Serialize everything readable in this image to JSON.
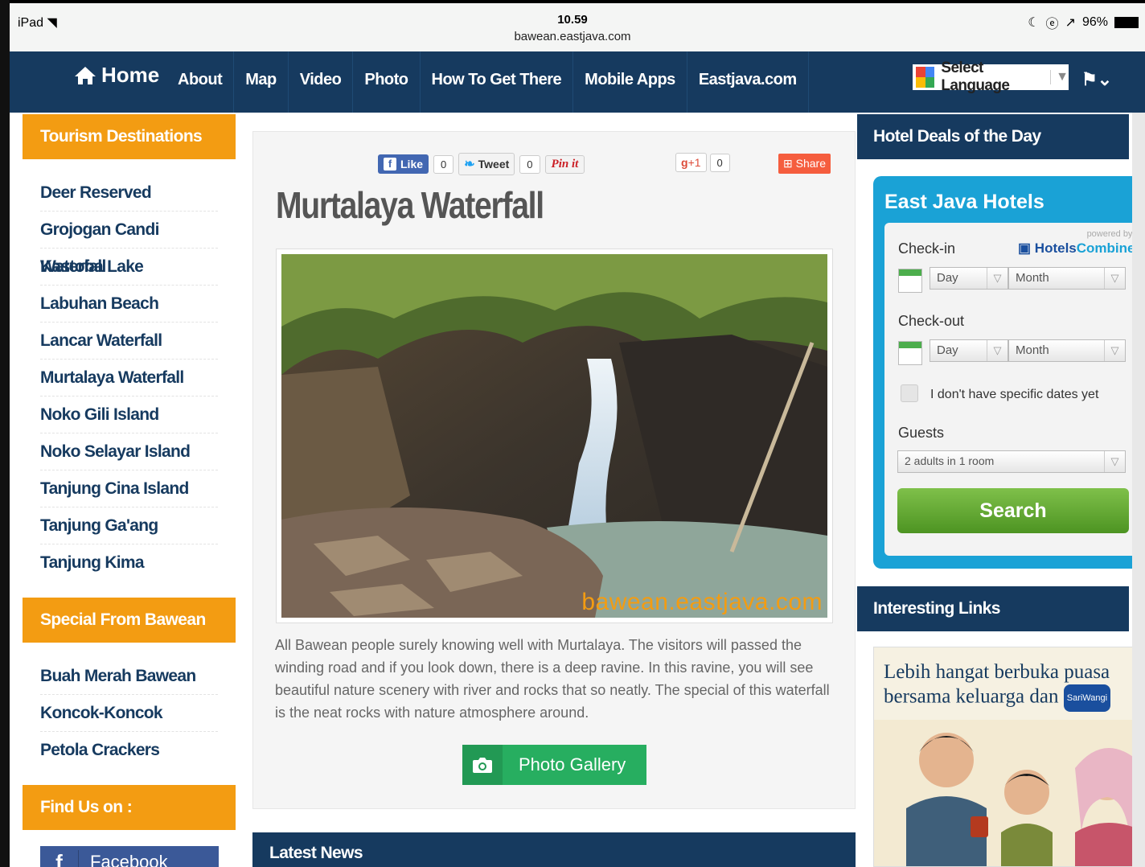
{
  "status_bar": {
    "device": "iPad",
    "time": "10.59",
    "url": "bawean.eastjava.com",
    "battery": "96%"
  },
  "nav": {
    "home": "Home",
    "items": [
      "About",
      "Map",
      "Video",
      "Photo",
      "How To Get There",
      "Mobile Apps",
      "Eastjava.com"
    ],
    "language": "Select Language"
  },
  "left_sidebar": {
    "tourism_title": "Tourism Destinations",
    "tourism_items": [
      "Deer Reserved",
      "Grojogan Candi Waterfall",
      "Kastoba Lake",
      "Labuhan Beach",
      "Lancar Waterfall",
      "Murtalaya Waterfall",
      "Noko Gili Island",
      "Noko Selayar Island",
      "Tanjung Cina Island",
      "Tanjung Ga'ang",
      "Tanjung Kima"
    ],
    "special_title": "Special From Bawean",
    "special_items": [
      "Buah Merah Bawean",
      "Koncok-Koncok",
      "Petola Crackers"
    ],
    "find_title": "Find Us on :",
    "facebook": "Facebook"
  },
  "main": {
    "share": {
      "like": "Like",
      "like_count": "0",
      "tweet": "Tweet",
      "tweet_count": "0",
      "pin": "Pin it",
      "gplus": "+1",
      "gplus_count": "0",
      "share": "Share"
    },
    "title": "Murtalaya Waterfall",
    "watermark": "bawean.eastjava.com",
    "description": "All Bawean people surely knowing well with Murtalaya. The visitors will passed the winding road and if you look down, there is a deep ravine. In this ravine, you will see beautiful nature scenery with river and rocks that so neatly. The special of this waterfall is the neat rocks with nature atmosphere around.",
    "gallery_button": "Photo Gallery",
    "latest_news": "Latest News"
  },
  "right_sidebar": {
    "hotel_deals_title": "Hotel Deals of the Day",
    "widget": {
      "title": "East Java Hotels",
      "powered_by": "powered by",
      "brand_a": "Hotels",
      "brand_b": "Combined",
      "checkin_label": "Check-in",
      "checkout_label": "Check-out",
      "day": "Day",
      "month": "Month",
      "no_dates": "I don't have specific dates yet",
      "guests_label": "Guests",
      "guests_value": "2 adults in 1 room",
      "search": "Search"
    },
    "links_title": "Interesting Links",
    "ad": {
      "line1": "Lebih hangat berbuka puasa",
      "line2": "bersama keluarga dan",
      "badge": "SariWangi"
    }
  },
  "colors": {
    "navy": "#163a5f",
    "orange": "#f39c12",
    "green": "#27ae60",
    "widget_blue": "#1aa2d6"
  }
}
